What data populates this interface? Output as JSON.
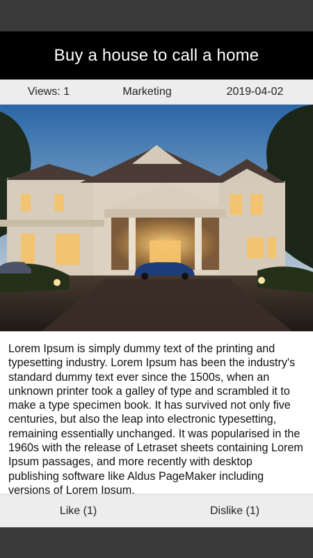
{
  "header": {
    "title": "Buy a house to call a home"
  },
  "meta": {
    "views": "Views: 1",
    "category": "Marketing",
    "date": "2019-04-02"
  },
  "photo": {
    "subject": "house-photo"
  },
  "article": {
    "body": "Lorem Ipsum is simply dummy text of the printing and typesetting industry. Lorem Ipsum has been the industry's standard dummy text ever since the 1500s, when an unknown printer took a galley of type and scrambled it to make a type specimen book. It has survived not only five centuries, but also the leap into electronic typesetting, remaining essentially unchanged. It was popularised in the 1960s with the release of Letraset sheets containing Lorem Ipsum passages, and more recently with desktop publishing software like Aldus PageMaker including versions of Lorem Ipsum."
  },
  "actions": {
    "like": "Like (1)",
    "dislike": "Dislike (1)"
  }
}
